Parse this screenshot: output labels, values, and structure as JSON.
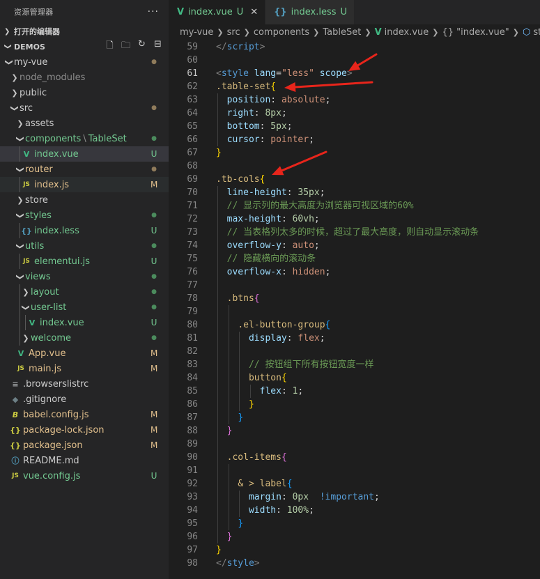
{
  "sidebar": {
    "title": "资源管理器",
    "more": "···",
    "open_editors": "打开的编辑器",
    "workspace": "DEMOS",
    "tree": [
      {
        "label": "my-vue",
        "type": "folder",
        "open": true,
        "depth": 0,
        "badge": "●",
        "badge_kind": "dot-mod"
      },
      {
        "label": "node_modules",
        "type": "folder",
        "open": false,
        "depth": 1,
        "dim": true
      },
      {
        "label": "public",
        "type": "folder",
        "open": false,
        "depth": 1
      },
      {
        "label": "src",
        "type": "folder",
        "open": true,
        "depth": 1,
        "badge": "●",
        "badge_kind": "dot-mod"
      },
      {
        "label": "assets",
        "type": "folder",
        "open": false,
        "depth": 2
      },
      {
        "label": "components",
        "label2": "TableSet",
        "type": "folder",
        "open": true,
        "depth": 2,
        "color": "green",
        "badge": "●",
        "badge_kind": "dot-green"
      },
      {
        "label": "index.vue",
        "type": "vue",
        "depth": 3,
        "color": "green",
        "badge": "U",
        "badge_kind": "green",
        "selected": true
      },
      {
        "label": "router",
        "type": "folder",
        "open": true,
        "depth": 2,
        "color": "mod",
        "badge": "●",
        "badge_kind": "dot-mod"
      },
      {
        "label": "index.js",
        "type": "js",
        "depth": 3,
        "color": "mod",
        "badge": "M",
        "badge_kind": "mod",
        "hover": true
      },
      {
        "label": "store",
        "type": "folder",
        "open": false,
        "depth": 2
      },
      {
        "label": "styles",
        "type": "folder",
        "open": true,
        "depth": 2,
        "color": "green",
        "badge": "●",
        "badge_kind": "dot-green"
      },
      {
        "label": "index.less",
        "type": "less",
        "depth": 3,
        "color": "green",
        "badge": "U",
        "badge_kind": "green"
      },
      {
        "label": "utils",
        "type": "folder",
        "open": true,
        "depth": 2,
        "color": "green",
        "badge": "●",
        "badge_kind": "dot-green"
      },
      {
        "label": "elementui.js",
        "type": "js",
        "depth": 3,
        "color": "green",
        "badge": "U",
        "badge_kind": "green"
      },
      {
        "label": "views",
        "type": "folder",
        "open": true,
        "depth": 2,
        "color": "green",
        "badge": "●",
        "badge_kind": "dot-green"
      },
      {
        "label": "layout",
        "type": "folder",
        "open": false,
        "depth": 3,
        "color": "green",
        "badge": "●",
        "badge_kind": "dot-green"
      },
      {
        "label": "user-list",
        "type": "folder",
        "open": true,
        "depth": 3,
        "color": "green",
        "badge": "●",
        "badge_kind": "dot-green"
      },
      {
        "label": "index.vue",
        "type": "vue",
        "depth": 4,
        "color": "green",
        "badge": "U",
        "badge_kind": "green"
      },
      {
        "label": "welcome",
        "type": "folder",
        "open": false,
        "depth": 3,
        "color": "green",
        "badge": "●",
        "badge_kind": "dot-green"
      },
      {
        "label": "App.vue",
        "type": "vue",
        "depth": 2,
        "color": "mod",
        "badge": "M",
        "badge_kind": "mod"
      },
      {
        "label": "main.js",
        "type": "js",
        "depth": 2,
        "color": "mod",
        "badge": "M",
        "badge_kind": "mod"
      },
      {
        "label": ".browserslistrc",
        "type": "lines",
        "depth": 1
      },
      {
        "label": ".gitignore",
        "type": "git",
        "depth": 1
      },
      {
        "label": "babel.config.js",
        "type": "babel",
        "depth": 1,
        "color": "mod",
        "badge": "M",
        "badge_kind": "mod"
      },
      {
        "label": "package-lock.json",
        "type": "json",
        "depth": 1,
        "color": "mod",
        "badge": "M",
        "badge_kind": "mod"
      },
      {
        "label": "package.json",
        "type": "json",
        "depth": 1,
        "color": "mod",
        "badge": "M",
        "badge_kind": "mod"
      },
      {
        "label": "README.md",
        "type": "info",
        "depth": 1
      },
      {
        "label": "vue.config.js",
        "type": "js",
        "depth": 1,
        "color": "green",
        "badge": "U",
        "badge_kind": "green"
      }
    ]
  },
  "tabs": [
    {
      "icon": "V",
      "label": "index.vue",
      "status": "U",
      "close": "✕",
      "active": true
    },
    {
      "icon": "{}",
      "label": "index.less",
      "status": "U",
      "active": false
    }
  ],
  "breadcrumb": {
    "parts": [
      "my-vue",
      "src",
      "components",
      "TableSet"
    ],
    "file": "index.vue",
    "scope": "{} \"index.vue\"",
    "symbol": "style"
  },
  "code": {
    "current_line": 61,
    "lines": [
      {
        "n": 59,
        "tokens": [
          [
            "t-punc",
            "</"
          ],
          [
            "t-tag",
            "script"
          ],
          [
            "t-punc",
            ">"
          ]
        ]
      },
      {
        "n": 60,
        "tokens": []
      },
      {
        "n": 61,
        "tokens": [
          [
            "t-punc",
            "<"
          ],
          [
            "t-tag",
            "style"
          ],
          [
            "t-plain",
            " "
          ],
          [
            "t-attr",
            "lang"
          ],
          [
            "t-plain",
            "="
          ],
          [
            "t-str",
            "\"less\""
          ],
          [
            "t-plain",
            " "
          ],
          [
            "t-attr",
            "scope"
          ],
          [
            "t-punc",
            ">"
          ]
        ]
      },
      {
        "n": 62,
        "tokens": [
          [
            "t-sel",
            ".table-set"
          ],
          [
            "t-brace",
            "{"
          ]
        ]
      },
      {
        "n": 63,
        "tokens": [
          [
            "t-plain",
            "  "
          ],
          [
            "t-prop",
            "position"
          ],
          [
            "t-plain",
            ": "
          ],
          [
            "t-val",
            "absolute"
          ],
          [
            "t-plain",
            ";"
          ]
        ]
      },
      {
        "n": 64,
        "tokens": [
          [
            "t-plain",
            "  "
          ],
          [
            "t-prop",
            "right"
          ],
          [
            "t-plain",
            ": "
          ],
          [
            "t-num",
            "8px"
          ],
          [
            "t-plain",
            ";"
          ]
        ]
      },
      {
        "n": 65,
        "tokens": [
          [
            "t-plain",
            "  "
          ],
          [
            "t-prop",
            "bottom"
          ],
          [
            "t-plain",
            ": "
          ],
          [
            "t-num",
            "5px"
          ],
          [
            "t-plain",
            ";"
          ]
        ]
      },
      {
        "n": 66,
        "tokens": [
          [
            "t-plain",
            "  "
          ],
          [
            "t-prop",
            "cursor"
          ],
          [
            "t-plain",
            ": "
          ],
          [
            "t-val",
            "pointer"
          ],
          [
            "t-plain",
            ";"
          ]
        ]
      },
      {
        "n": 67,
        "tokens": [
          [
            "t-brace",
            "}"
          ]
        ]
      },
      {
        "n": 68,
        "tokens": []
      },
      {
        "n": 69,
        "tokens": [
          [
            "t-sel",
            ".tb-cols"
          ],
          [
            "t-brace",
            "{"
          ]
        ]
      },
      {
        "n": 70,
        "tokens": [
          [
            "t-plain",
            "  "
          ],
          [
            "t-prop",
            "line-height"
          ],
          [
            "t-plain",
            ": "
          ],
          [
            "t-num",
            "35px"
          ],
          [
            "t-plain",
            ";"
          ]
        ]
      },
      {
        "n": 71,
        "tokens": [
          [
            "t-plain",
            "  "
          ],
          [
            "t-com",
            "// 显示列的最大高度为浏览器可视区域的60%"
          ]
        ]
      },
      {
        "n": 72,
        "tokens": [
          [
            "t-plain",
            "  "
          ],
          [
            "t-prop",
            "max-height"
          ],
          [
            "t-plain",
            ": "
          ],
          [
            "t-num",
            "60vh"
          ],
          [
            "t-plain",
            ";"
          ]
        ]
      },
      {
        "n": 73,
        "tokens": [
          [
            "t-plain",
            "  "
          ],
          [
            "t-com",
            "// 当表格列太多的时候，超过了最大高度，则自动显示滚动条"
          ]
        ]
      },
      {
        "n": 74,
        "tokens": [
          [
            "t-plain",
            "  "
          ],
          [
            "t-prop",
            "overflow-y"
          ],
          [
            "t-plain",
            ": "
          ],
          [
            "t-val",
            "auto"
          ],
          [
            "t-plain",
            ";"
          ]
        ]
      },
      {
        "n": 75,
        "tokens": [
          [
            "t-plain",
            "  "
          ],
          [
            "t-com",
            "// 隐藏横向的滚动条"
          ]
        ]
      },
      {
        "n": 76,
        "tokens": [
          [
            "t-plain",
            "  "
          ],
          [
            "t-prop",
            "overflow-x"
          ],
          [
            "t-plain",
            ": "
          ],
          [
            "t-val",
            "hidden"
          ],
          [
            "t-plain",
            ";"
          ]
        ]
      },
      {
        "n": 77,
        "tokens": []
      },
      {
        "n": 78,
        "tokens": [
          [
            "t-plain",
            "  "
          ],
          [
            "t-sel",
            ".btns"
          ],
          [
            "t-brace2",
            "{"
          ]
        ]
      },
      {
        "n": 79,
        "tokens": []
      },
      {
        "n": 80,
        "tokens": [
          [
            "t-plain",
            "    "
          ],
          [
            "t-sel",
            ".el-button-group"
          ],
          [
            "t-brace3",
            "{"
          ]
        ]
      },
      {
        "n": 81,
        "tokens": [
          [
            "t-plain",
            "      "
          ],
          [
            "t-prop",
            "display"
          ],
          [
            "t-plain",
            ": "
          ],
          [
            "t-val",
            "flex"
          ],
          [
            "t-plain",
            ";"
          ]
        ]
      },
      {
        "n": 82,
        "tokens": []
      },
      {
        "n": 83,
        "tokens": [
          [
            "t-plain",
            "      "
          ],
          [
            "t-com",
            "// 按钮组下所有按钮宽度一样"
          ]
        ]
      },
      {
        "n": 84,
        "tokens": [
          [
            "t-plain",
            "      "
          ],
          [
            "t-sel",
            "button"
          ],
          [
            "t-brace",
            "{"
          ]
        ]
      },
      {
        "n": 85,
        "tokens": [
          [
            "t-plain",
            "        "
          ],
          [
            "t-prop",
            "flex"
          ],
          [
            "t-plain",
            ": "
          ],
          [
            "t-num",
            "1"
          ],
          [
            "t-plain",
            ";"
          ]
        ]
      },
      {
        "n": 86,
        "tokens": [
          [
            "t-plain",
            "      "
          ],
          [
            "t-brace",
            "}"
          ]
        ]
      },
      {
        "n": 87,
        "tokens": [
          [
            "t-plain",
            "    "
          ],
          [
            "t-brace3",
            "}"
          ]
        ]
      },
      {
        "n": 88,
        "tokens": [
          [
            "t-plain",
            "  "
          ],
          [
            "t-brace2",
            "}"
          ]
        ]
      },
      {
        "n": 89,
        "tokens": []
      },
      {
        "n": 90,
        "tokens": [
          [
            "t-plain",
            "  "
          ],
          [
            "t-sel",
            ".col-items"
          ],
          [
            "t-brace2",
            "{"
          ]
        ]
      },
      {
        "n": 91,
        "tokens": []
      },
      {
        "n": 92,
        "tokens": [
          [
            "t-plain",
            "    "
          ],
          [
            "t-sel",
            "& > label"
          ],
          [
            "t-brace3",
            "{"
          ]
        ]
      },
      {
        "n": 93,
        "tokens": [
          [
            "t-plain",
            "      "
          ],
          [
            "t-prop",
            "margin"
          ],
          [
            "t-plain",
            ": "
          ],
          [
            "t-num",
            "0px"
          ],
          [
            "t-plain",
            "  "
          ],
          [
            "t-imp",
            "!important"
          ],
          [
            "t-plain",
            ";"
          ]
        ]
      },
      {
        "n": 94,
        "tokens": [
          [
            "t-plain",
            "      "
          ],
          [
            "t-prop",
            "width"
          ],
          [
            "t-plain",
            ": "
          ],
          [
            "t-num",
            "100%"
          ],
          [
            "t-plain",
            ";"
          ]
        ]
      },
      {
        "n": 95,
        "tokens": [
          [
            "t-plain",
            "    "
          ],
          [
            "t-brace3",
            "}"
          ]
        ]
      },
      {
        "n": 96,
        "tokens": [
          [
            "t-plain",
            "  "
          ],
          [
            "t-brace2",
            "}"
          ]
        ]
      },
      {
        "n": 97,
        "tokens": [
          [
            "t-brace",
            "}"
          ]
        ]
      },
      {
        "n": 98,
        "tokens": [
          [
            "t-punc",
            "</"
          ],
          [
            "t-tag",
            "style"
          ],
          [
            "t-punc",
            ">"
          ]
        ]
      }
    ]
  },
  "colors": {
    "annotation_arrow": "#e8251b",
    "untracked": "#73c991",
    "modified": "#e2c08d"
  }
}
